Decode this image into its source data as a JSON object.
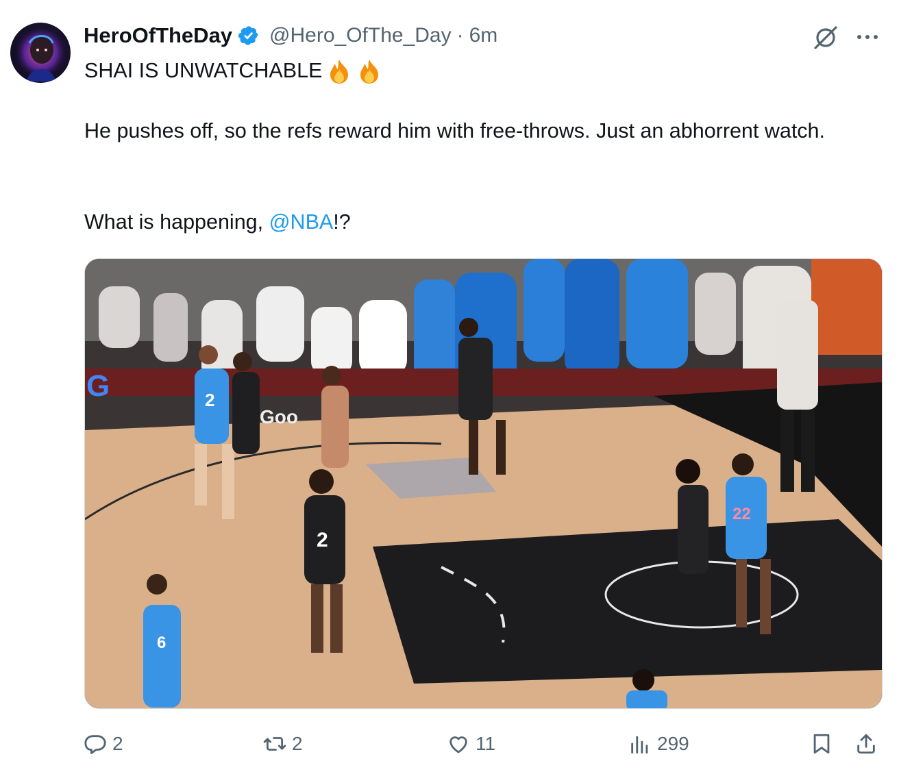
{
  "tweet": {
    "author_name": "HeroOfTheDay",
    "handle": "@Hero_OfThe_Day",
    "separator": "·",
    "time": "6m",
    "line1": "SHAI IS UNWATCHABLE",
    "line2": "He pushes off, so the refs reward him with free-throws. Just an abhorrent watch.",
    "line3_prefix": "What is happening, ",
    "mention": "@NBA",
    "line3_suffix": "!?",
    "emojis": [
      "fire-icon",
      "fire-icon"
    ]
  },
  "media": {
    "jersey_numbers": [
      "2",
      "2",
      "22",
      "6"
    ],
    "court_text": [
      "Goo"
    ],
    "icons": [
      "google-logo"
    ]
  },
  "actions": {
    "replies": "2",
    "reposts": "2",
    "likes": "11",
    "views": "299"
  },
  "icons": [
    "verified-badge-icon",
    "grok-icon",
    "more-icon",
    "reply-icon",
    "repost-icon",
    "like-icon",
    "views-icon",
    "bookmark-icon",
    "share-icon"
  ],
  "colors": {
    "verified": "#1d9bf0",
    "link": "#1d9bf0",
    "secondary_text": "#536471",
    "court_wood": "#d9b08a",
    "paint_black": "#1c1c1e",
    "thunder_blue": "#2f8fe0"
  }
}
